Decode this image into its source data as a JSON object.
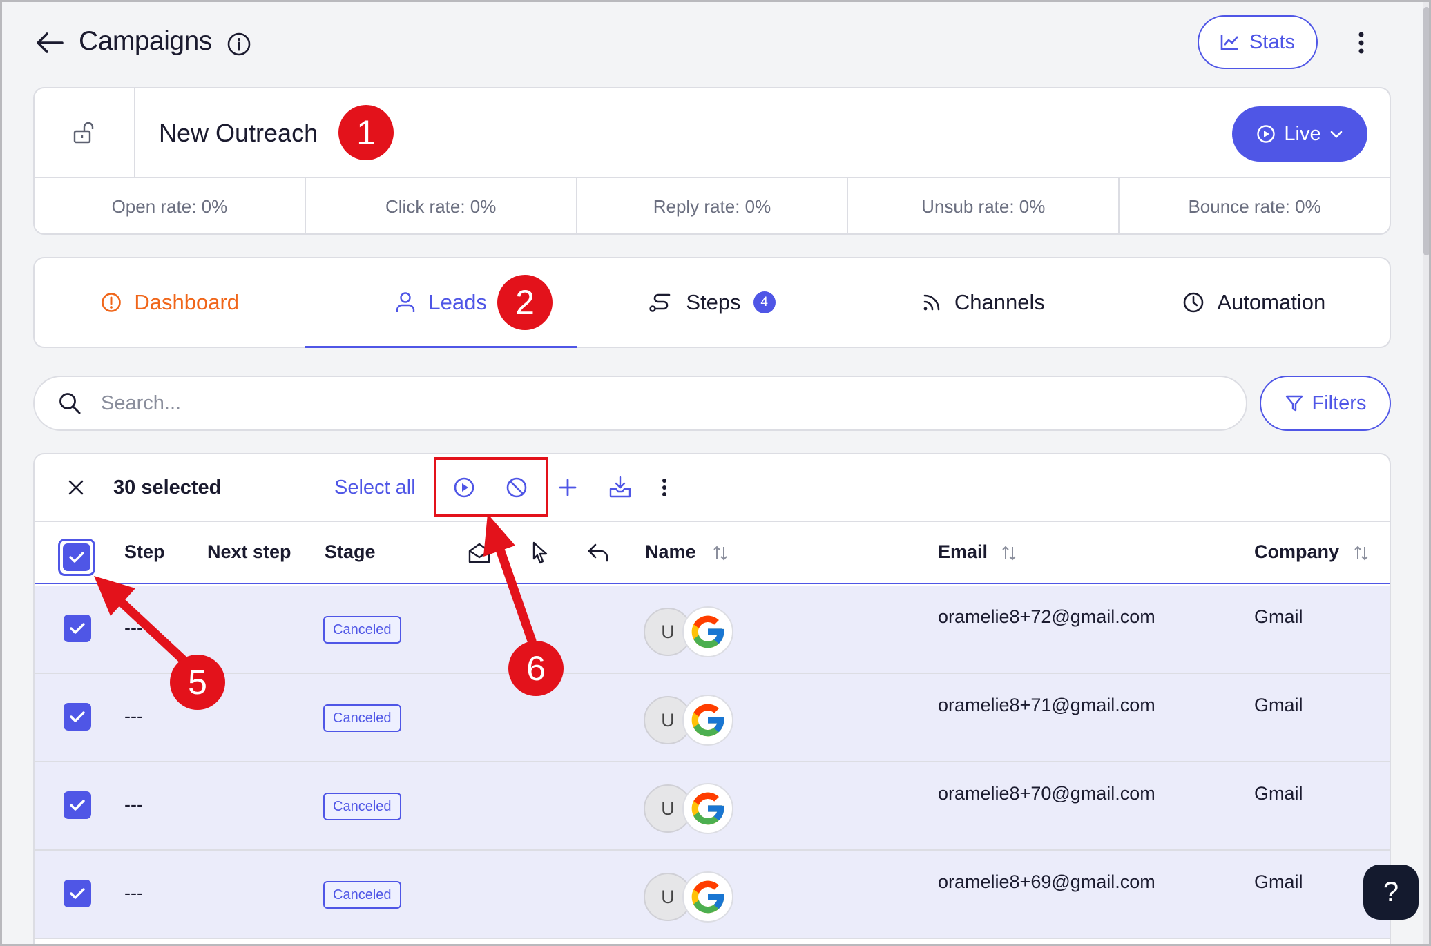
{
  "header": {
    "title": "Campaigns",
    "stats_label": "Stats"
  },
  "campaign": {
    "name": "New Outreach",
    "status_label": "Live",
    "rates": [
      {
        "label": "Open rate: 0%"
      },
      {
        "label": "Click rate: 0%"
      },
      {
        "label": "Reply rate: 0%"
      },
      {
        "label": "Unsub rate: 0%"
      },
      {
        "label": "Bounce rate: 0%"
      }
    ]
  },
  "tabs": [
    {
      "label": "Dashboard",
      "icon": "alert-circle-icon"
    },
    {
      "label": "Leads",
      "icon": "user-icon",
      "active": true
    },
    {
      "label": "Steps",
      "icon": "route-icon",
      "badge": "4"
    },
    {
      "label": "Channels",
      "icon": "rss-icon"
    },
    {
      "label": "Automation",
      "icon": "clock-icon"
    }
  ],
  "search": {
    "placeholder": "Search...",
    "filters_label": "Filters"
  },
  "bulk": {
    "selected_label": "30 selected",
    "select_all_label": "Select all"
  },
  "table": {
    "columns": {
      "step": "Step",
      "next_step": "Next step",
      "stage": "Stage",
      "name": "Name",
      "email": "Email",
      "company": "Company"
    },
    "rows": [
      {
        "step": "---",
        "stage": "Canceled",
        "avatar": "U",
        "email": "oramelie8+72@gmail.com",
        "company": "Gmail"
      },
      {
        "step": "---",
        "stage": "Canceled",
        "avatar": "U",
        "email": "oramelie8+71@gmail.com",
        "company": "Gmail"
      },
      {
        "step": "---",
        "stage": "Canceled",
        "avatar": "U",
        "email": "oramelie8+70@gmail.com",
        "company": "Gmail"
      },
      {
        "step": "---",
        "stage": "Canceled",
        "avatar": "U",
        "email": "oramelie8+69@gmail.com",
        "company": "Gmail"
      }
    ]
  },
  "annotations": {
    "m1": "1",
    "m2": "2",
    "m5": "5",
    "m6": "6"
  },
  "help_label": "?",
  "colors": {
    "accent": "#4f56e6",
    "dashboard": "#f0661a",
    "annotation": "#e3121b",
    "row_selected": "#ebecfa"
  }
}
